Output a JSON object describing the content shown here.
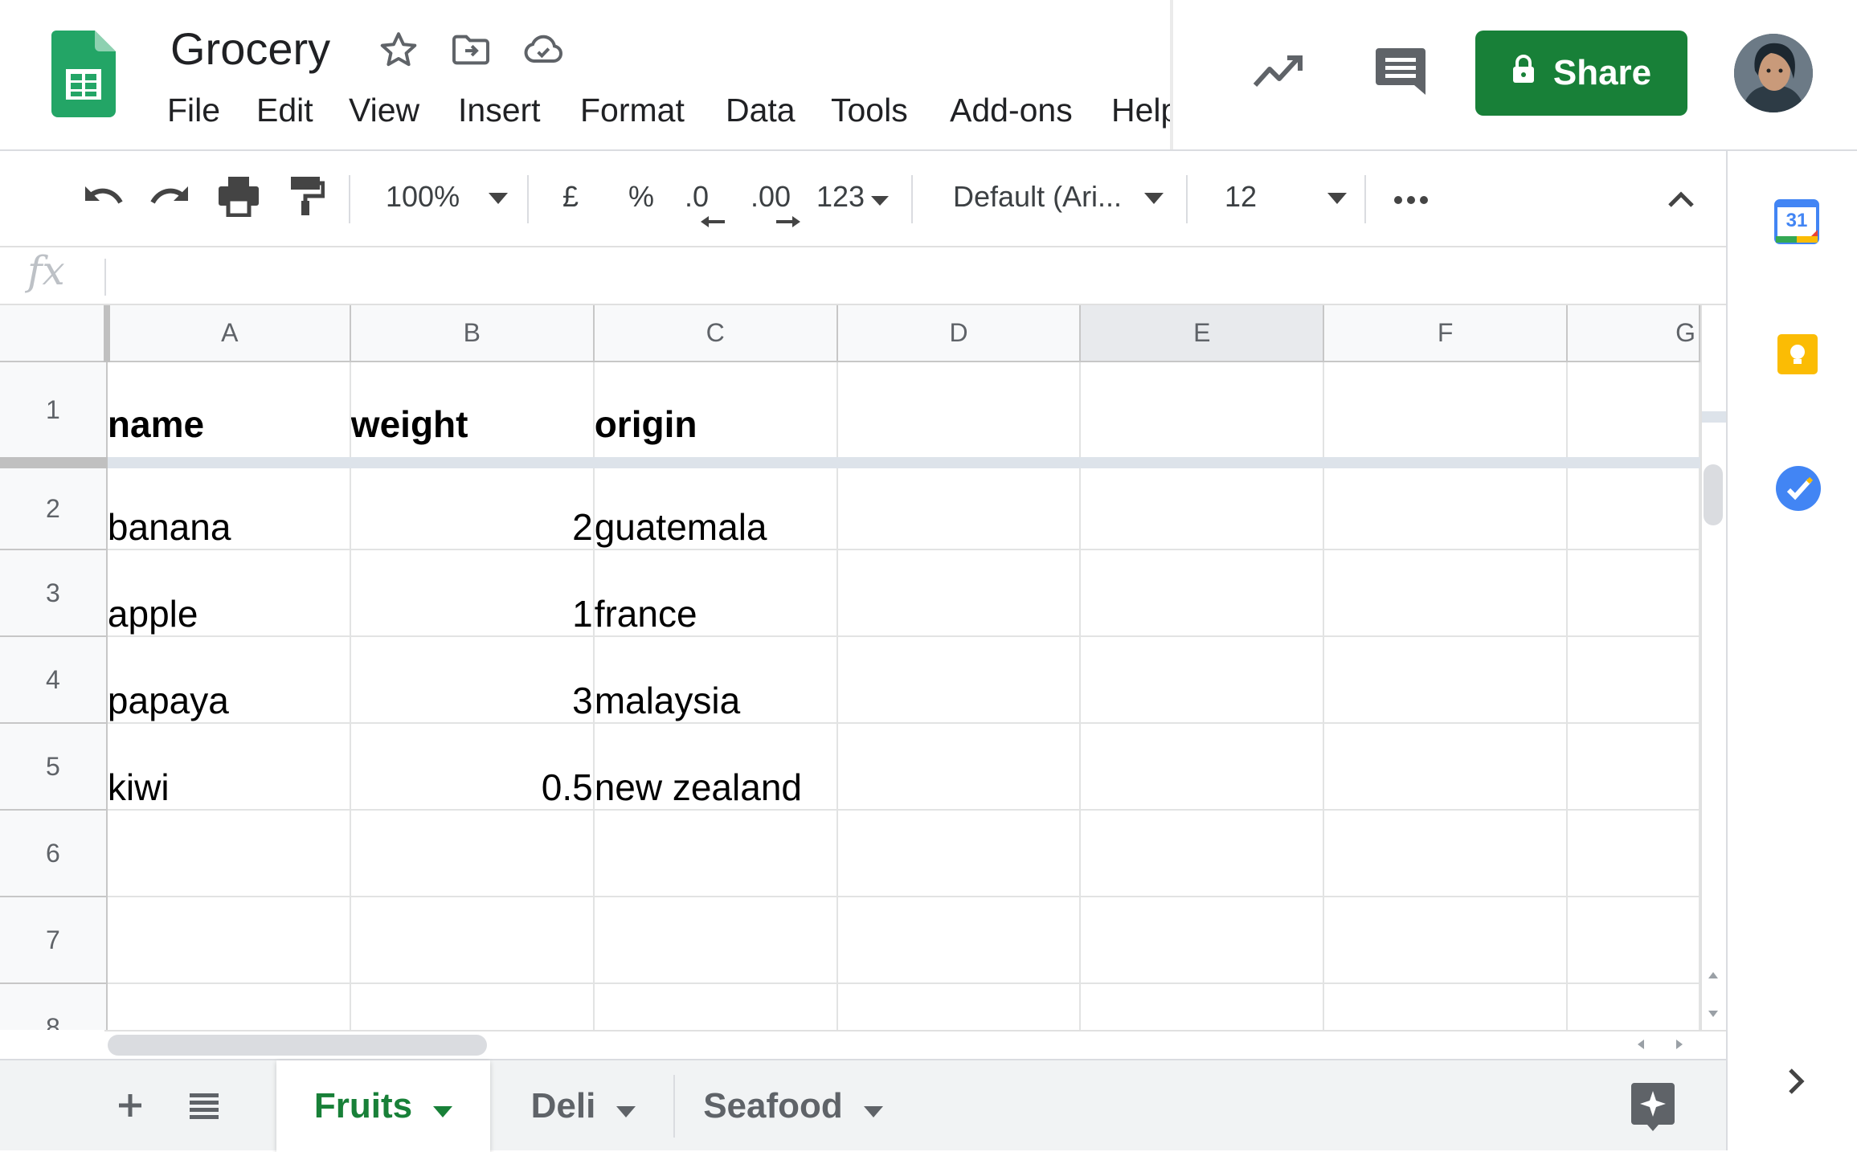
{
  "app": {
    "doc_title": "Grocery",
    "menu": [
      "File",
      "Edit",
      "View",
      "Insert",
      "Format",
      "Data",
      "Tools",
      "Add-ons",
      "Help"
    ],
    "share_label": "Share",
    "accent_color": "#188038"
  },
  "toolbar": {
    "zoom": "100%",
    "currency": "£",
    "percent": "%",
    "decrease_decimal": ".0",
    "increase_decimal": ".00",
    "more_formats": "123",
    "font": "Default (Ari...",
    "font_size": "12"
  },
  "formula_bar": {
    "label": "fx",
    "value": ""
  },
  "sheet": {
    "columns": [
      "A",
      "B",
      "C",
      "D",
      "E",
      "F",
      "G"
    ],
    "selected_column": "E",
    "rows": [
      {
        "num": "1",
        "cells": [
          "name",
          "weight",
          "origin",
          "",
          "",
          "",
          ""
        ]
      },
      {
        "num": "2",
        "cells": [
          "banana",
          "2",
          "guatemala",
          "",
          "",
          "",
          ""
        ]
      },
      {
        "num": "3",
        "cells": [
          "apple",
          "1",
          "france",
          "",
          "",
          "",
          ""
        ]
      },
      {
        "num": "4",
        "cells": [
          "papaya",
          "3",
          "malaysia",
          "",
          "",
          "",
          ""
        ]
      },
      {
        "num": "5",
        "cells": [
          "kiwi",
          "0.5",
          "new zealand",
          "",
          "",
          "",
          ""
        ]
      },
      {
        "num": "6",
        "cells": [
          "",
          "",
          "",
          "",
          "",
          "",
          ""
        ]
      },
      {
        "num": "7",
        "cells": [
          "",
          "",
          "",
          "",
          "",
          "",
          ""
        ]
      },
      {
        "num": "8",
        "cells": [
          "",
          "",
          "",
          "",
          "",
          "",
          ""
        ]
      }
    ]
  },
  "tabs": [
    {
      "label": "Fruits",
      "active": true
    },
    {
      "label": "Deli",
      "active": false
    },
    {
      "label": "Seafood",
      "active": false
    }
  ],
  "side_panel": {
    "calendar_day": "31",
    "icons": [
      "calendar-icon",
      "keep-icon",
      "tasks-icon"
    ]
  }
}
